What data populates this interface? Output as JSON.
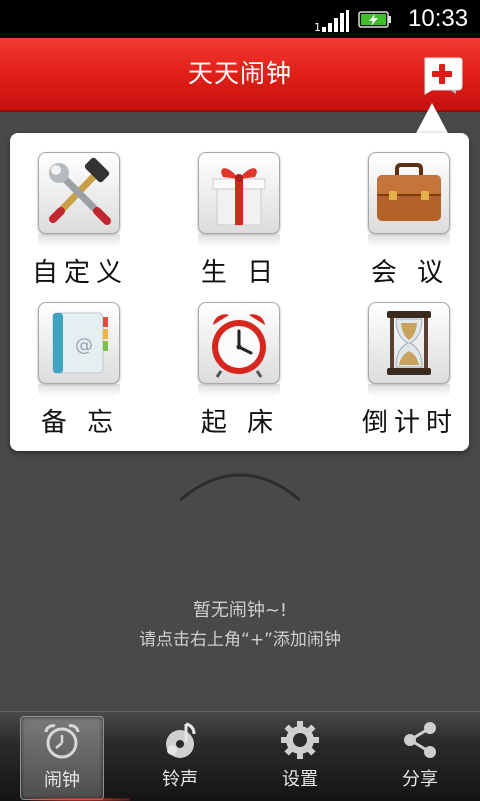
{
  "status_bar": {
    "time": "10:33"
  },
  "header": {
    "title": "天天闹钟",
    "add_icon": "plus-icon"
  },
  "popup_menu": {
    "items": [
      {
        "label": "自定义",
        "icon": "wrench-hammer-icon"
      },
      {
        "label": "生 日",
        "icon": "gift-icon"
      },
      {
        "label": "会 议",
        "icon": "briefcase-icon"
      },
      {
        "label": "备 忘",
        "icon": "notebook-icon"
      },
      {
        "label": "起 床",
        "icon": "alarm-clock-icon"
      },
      {
        "label": "倒计时",
        "icon": "hourglass-icon"
      }
    ]
  },
  "empty_state": {
    "title": "暂无闹钟~!",
    "hint": "请点击右上角“+”添加闹钟"
  },
  "tab_bar": {
    "tabs": [
      {
        "label": "闹钟",
        "icon": "alarm-icon",
        "active": true
      },
      {
        "label": "铃声",
        "icon": "music-note-icon",
        "active": false
      },
      {
        "label": "设置",
        "icon": "gear-icon",
        "active": false
      },
      {
        "label": "分享",
        "icon": "share-icon",
        "active": false
      }
    ]
  },
  "colors": {
    "title_bar": "#df1d17",
    "background": "#4b4948",
    "accent": "#ff3b2f"
  }
}
